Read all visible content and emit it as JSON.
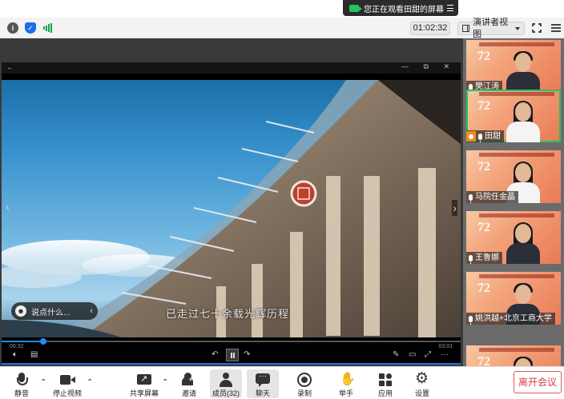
{
  "banner": {
    "text": "您正在观看田甜的屏幕"
  },
  "status": {
    "timer": "01:02:32",
    "view_mode": "演讲者视图"
  },
  "video": {
    "subtitle": "已走过七十余载光辉历程",
    "comment_placeholder": "说点什么...",
    "time_current": "00:32",
    "time_total": "03:01",
    "progress_fraction": 0.09
  },
  "participants": [
    {
      "name": "樊江涛",
      "selected": false,
      "long_hair": false,
      "white_shirt": false
    },
    {
      "name": "田甜",
      "selected": true,
      "long_hair": true,
      "white_shirt": true,
      "presenting": true
    },
    {
      "name": "马院任金晶",
      "selected": false,
      "long_hair": true,
      "white_shirt": true
    },
    {
      "name": "王鲁娜",
      "selected": false,
      "long_hair": true,
      "white_shirt": false
    },
    {
      "name": "姚洪越+北京工商大学",
      "selected": false,
      "long_hair": false,
      "white_shirt": false
    },
    {
      "name": "",
      "selected": false,
      "long_hair": false,
      "white_shirt": false
    }
  ],
  "toolbar": {
    "mute": "静音",
    "stop_video": "停止视频",
    "share_screen": "共享屏幕",
    "invite": "邀请",
    "members": "成员(32)",
    "chat": "聊天",
    "record": "录制",
    "raise_hand": "举手",
    "apps": "应用",
    "settings": "设置",
    "leave": "离开会议"
  },
  "colors": {
    "accent": "#1d6fe8",
    "selected_tile": "#22c55e",
    "leave": "#e03a3a",
    "presenter_badge": "#f08c1e"
  }
}
